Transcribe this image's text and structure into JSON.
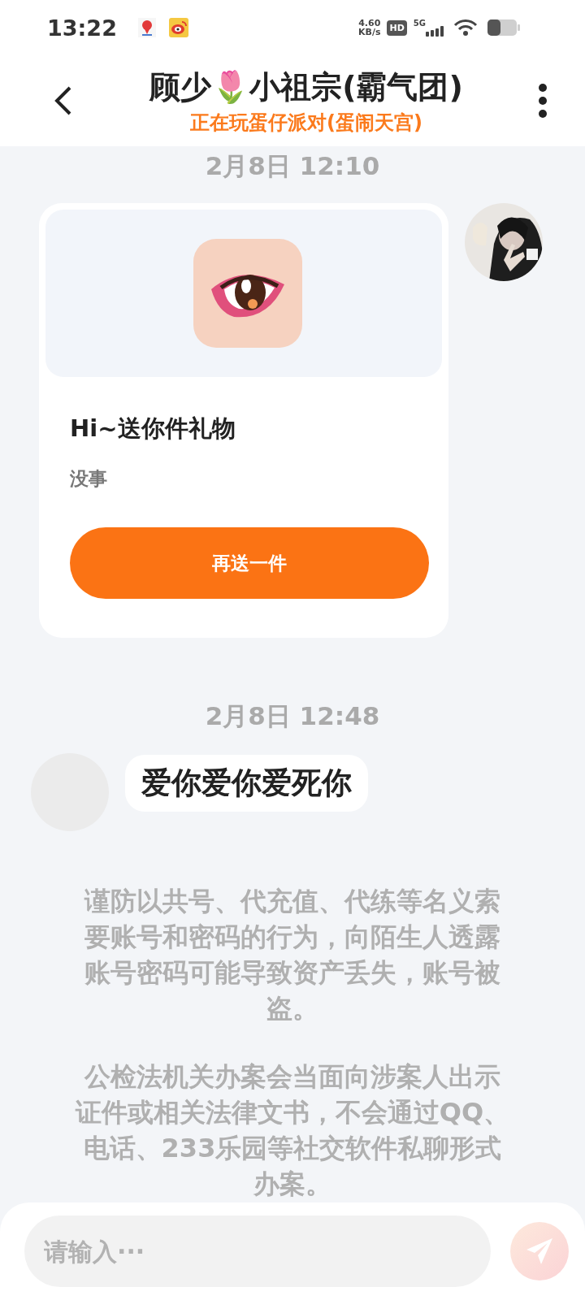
{
  "status_bar": {
    "time": "13:22",
    "net_speed": "4.60",
    "net_unit": "KB/s",
    "hd": "HD",
    "network": "5G"
  },
  "header": {
    "title": "顾少🌷小祖宗(霸气团)",
    "subtitle": "正在玩蛋仔派对(蛋闹天宫)"
  },
  "messages": [
    {
      "kind": "timestamp",
      "text": "2月8日 12:10"
    },
    {
      "kind": "gift",
      "title": "Hi~送你件礼物",
      "note": "没事",
      "button": "再送一件"
    },
    {
      "kind": "timestamp",
      "text": "2月8日 12:48"
    },
    {
      "kind": "text",
      "text": "爱你爱你爱死你"
    },
    {
      "kind": "notice",
      "text": "谨防以共号、代充值、代练等名义索要账号和密码的行为，向陌生人透露账号密码可能导致资产丢失，账号被盗。"
    },
    {
      "kind": "notice",
      "text": "公检法机关办案会当面向涉案人出示证件或相关法律文书，不会通过QQ、电话、233乐园等社交软件私聊形式办案。"
    }
  ],
  "composer": {
    "placeholder": "请输入···"
  }
}
